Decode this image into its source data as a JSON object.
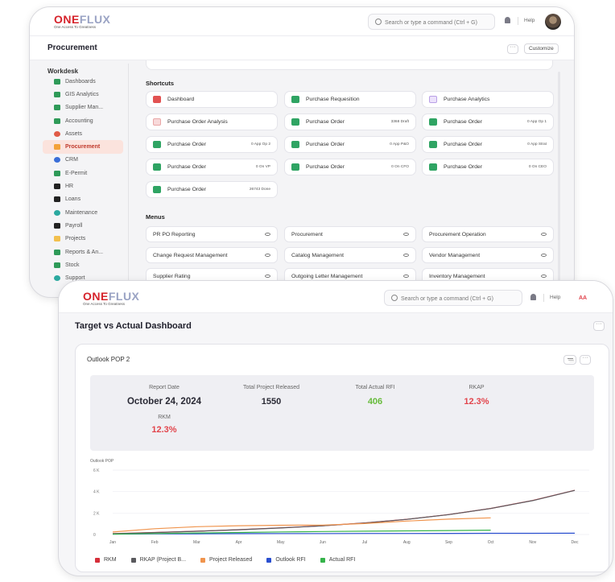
{
  "brand": {
    "name_main": "ONE",
    "name_light": "FLUX",
    "tagline": "One Access To Greatness"
  },
  "back_window": {
    "search_placeholder": "Search or type a command (Ctrl + G)",
    "help_label": "Help",
    "page_title": "Procurement",
    "dots_label": "···",
    "customize_label": "Customize",
    "sidebar_heading": "Workdesk",
    "sidebar": [
      {
        "label": "Dashboards",
        "icon": "dashboard-icon",
        "active": false
      },
      {
        "label": "GIS Analytics",
        "icon": "map-icon",
        "active": false
      },
      {
        "label": "Supplier Man...",
        "icon": "supplier-icon",
        "active": false
      },
      {
        "label": "Accounting",
        "icon": "accounting-icon",
        "active": false
      },
      {
        "label": "Assets",
        "icon": "assets-icon",
        "active": false
      },
      {
        "label": "Procurement",
        "icon": "procurement-icon",
        "active": true
      },
      {
        "label": "CRM",
        "icon": "crm-icon",
        "active": false
      },
      {
        "label": "E-Permit",
        "icon": "permit-icon",
        "active": false
      },
      {
        "label": "HR",
        "icon": "hr-icon",
        "active": false
      },
      {
        "label": "Loans",
        "icon": "loans-icon",
        "active": false
      },
      {
        "label": "Maintenance",
        "icon": "maintenance-icon",
        "active": false
      },
      {
        "label": "Payroll",
        "icon": "payroll-icon",
        "active": false
      },
      {
        "label": "Projects",
        "icon": "folder-icon",
        "active": false
      },
      {
        "label": "Reports & An...",
        "icon": "reports-icon",
        "active": false
      },
      {
        "label": "Stock",
        "icon": "stock-icon",
        "active": false
      },
      {
        "label": "Support",
        "icon": "support-icon",
        "active": false
      }
    ],
    "shortcuts_heading": "Shortcuts",
    "shortcuts": [
      {
        "label": "Dashboard",
        "count": "",
        "icon": "red"
      },
      {
        "label": "Purchase Requesition",
        "count": "",
        "icon": "green"
      },
      {
        "label": "Purchase Analytics",
        "count": "",
        "icon": "purple"
      },
      {
        "label": "Purchase Order Analysis",
        "count": "",
        "icon": "pink"
      },
      {
        "label": "Purchase Order",
        "count": "3368 Draft",
        "icon": "green"
      },
      {
        "label": "Purchase Order",
        "count": "0 App Op 1",
        "icon": "green"
      },
      {
        "label": "Purchase Order",
        "count": "0 App Op 2",
        "icon": "green"
      },
      {
        "label": "Purchase Order",
        "count": "0 App P&O",
        "icon": "green"
      },
      {
        "label": "Purchase Order",
        "count": "0 App Strat",
        "icon": "green"
      },
      {
        "label": "Purchase Order",
        "count": "0 On VP",
        "icon": "green"
      },
      {
        "label": "Purchase Order",
        "count": "0 On CFO",
        "icon": "green"
      },
      {
        "label": "Purchase Order",
        "count": "0 On CEO",
        "icon": "green"
      },
      {
        "label": "Purchase Order",
        "count": "26743 Done",
        "icon": "green"
      }
    ],
    "menus_heading": "Menus",
    "menus": [
      "PR PO Reporting",
      "Procurement",
      "Procurement Operation",
      "Change Request Management",
      "Catalog Management",
      "Vendor Management",
      "Supplier Rating",
      "Outgoing Letter Management",
      "Inventory Management"
    ]
  },
  "front_window": {
    "search_placeholder": "Search or type a command (Ctrl + G)",
    "help_label": "Help",
    "avatar_initials": "AA",
    "dashboard_title": "Target vs Actual Dashboard",
    "dots_label": "···",
    "panel_title": "Outlook POP 2",
    "kpis": {
      "report_date_label": "Report Date",
      "report_date": "October 24, 2024",
      "total_project_released_label": "Total Project Released",
      "total_project_released": "1550",
      "total_actual_rfi_label": "Total Actual RFI",
      "total_actual_rfi": "406",
      "rkap_label": "RKAP",
      "rkap": "12.3%",
      "rkm_label": "RKM",
      "rkm": "12.3%"
    },
    "colors": {
      "green": "#66bb3a",
      "red": "#e2454c"
    }
  },
  "chart_data": {
    "type": "line",
    "title": "Outlook POP",
    "categories": [
      "Jan",
      "Feb",
      "Mar",
      "Apr",
      "May",
      "Jun",
      "Jul",
      "Aug",
      "Sep",
      "Oct",
      "Nov",
      "Dec"
    ],
    "y_ticks": [
      "0",
      "2 K",
      "4 K",
      "6 K"
    ],
    "ylim": [
      0,
      6000
    ],
    "legend_position": "bottom",
    "series": [
      {
        "name": "RKM",
        "color": "#d62f3a",
        "values": [
          80,
          190,
          310,
          450,
          620,
          820,
          1080,
          1420,
          1860,
          2430,
          3170,
          4120
        ]
      },
      {
        "name": "RKAP (Project B...",
        "color": "#5a5a5e",
        "values": [
          70,
          180,
          300,
          440,
          610,
          810,
          1070,
          1410,
          1850,
          2420,
          3160,
          4110
        ]
      },
      {
        "name": "Project Released",
        "color": "#f0944d",
        "values": [
          230,
          540,
          730,
          820,
          860,
          880,
          1020,
          1250,
          1430,
          1550,
          null,
          null
        ]
      },
      {
        "name": "Outlook RFI",
        "color": "#2a4fd0",
        "values": [
          40,
          60,
          70,
          80,
          90,
          90,
          95,
          100,
          105,
          110,
          115,
          120
        ]
      },
      {
        "name": "Actual RFI",
        "color": "#35b34a",
        "values": [
          40,
          90,
          140,
          190,
          240,
          280,
          310,
          340,
          370,
          406,
          null,
          null
        ]
      }
    ]
  }
}
